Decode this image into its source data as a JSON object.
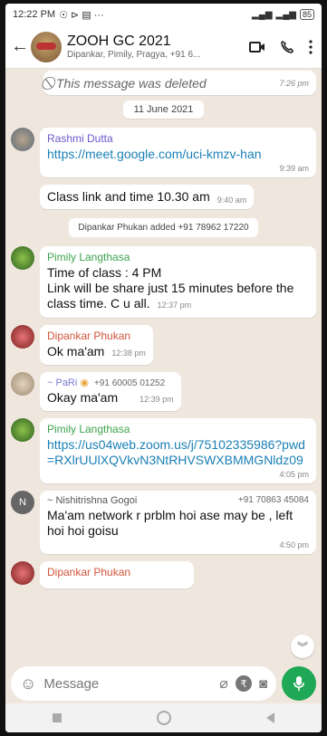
{
  "status_bar": {
    "time": "12:22 PM",
    "left_icons": "☉ ⊳ ▤ ···",
    "battery": "85"
  },
  "header": {
    "title": "ZOOH GC 2021",
    "subtitle": "Dipankar, Pimily, Pragya, +91 6..."
  },
  "messages": {
    "deleted": {
      "text": "This message was deleted",
      "time": "7:26 pm"
    },
    "date": "11 June 2021",
    "rashmi": {
      "sender": "Rashmi Dutta",
      "text": "https://meet.google.com/uci-kmzv-han",
      "time": "9:39 am",
      "color": "#6a5acd"
    },
    "rashmi2": {
      "text": "Class link and time 10.30 am",
      "time": "9:40 am"
    },
    "system": "Dipankar Phukan added +91 78962 17220",
    "pimily1": {
      "sender": "Pimily Langthasa",
      "line1": "Time of class : 4 PM",
      "line2": "Link will be share just 15 minutes before the class time.  C u all.",
      "time": "12:37 pm",
      "color": "#3da34d"
    },
    "dipankar1": {
      "sender": "Dipankar Phukan",
      "text": "Ok ma'am",
      "time": "12:38 pm",
      "color": "#d2553b"
    },
    "pari": {
      "sender": "~ PaRi",
      "phone": "+91 60005 01252",
      "text": "Okay ma'am",
      "time": "12:39 pm",
      "color": "#7a7ad8"
    },
    "pimily2": {
      "sender": "Pimily Langthasa",
      "text": "https://us04web.zoom.us/j/75102335986?pwd=RXlrUUlXQVkvN3NtRHVSWXBMMGNldz09",
      "time": "4:05 pm",
      "color": "#3da34d"
    },
    "nishi": {
      "sender": "~ Nishitrishna Gogoi",
      "phone": "+91 70863 45084",
      "text": "Ma'am network r prblm hoi ase may be , left hoi hoi goisu",
      "time": "4:50 pm",
      "color": "#555555"
    },
    "dipankar2": {
      "sender": "Dipankar Phukan",
      "color": "#d2553b"
    }
  },
  "composer": {
    "placeholder": "Message"
  },
  "colors": {
    "accent": "#1fa855",
    "link": "#1a7fb5",
    "chat_bg": "#efe7de"
  }
}
